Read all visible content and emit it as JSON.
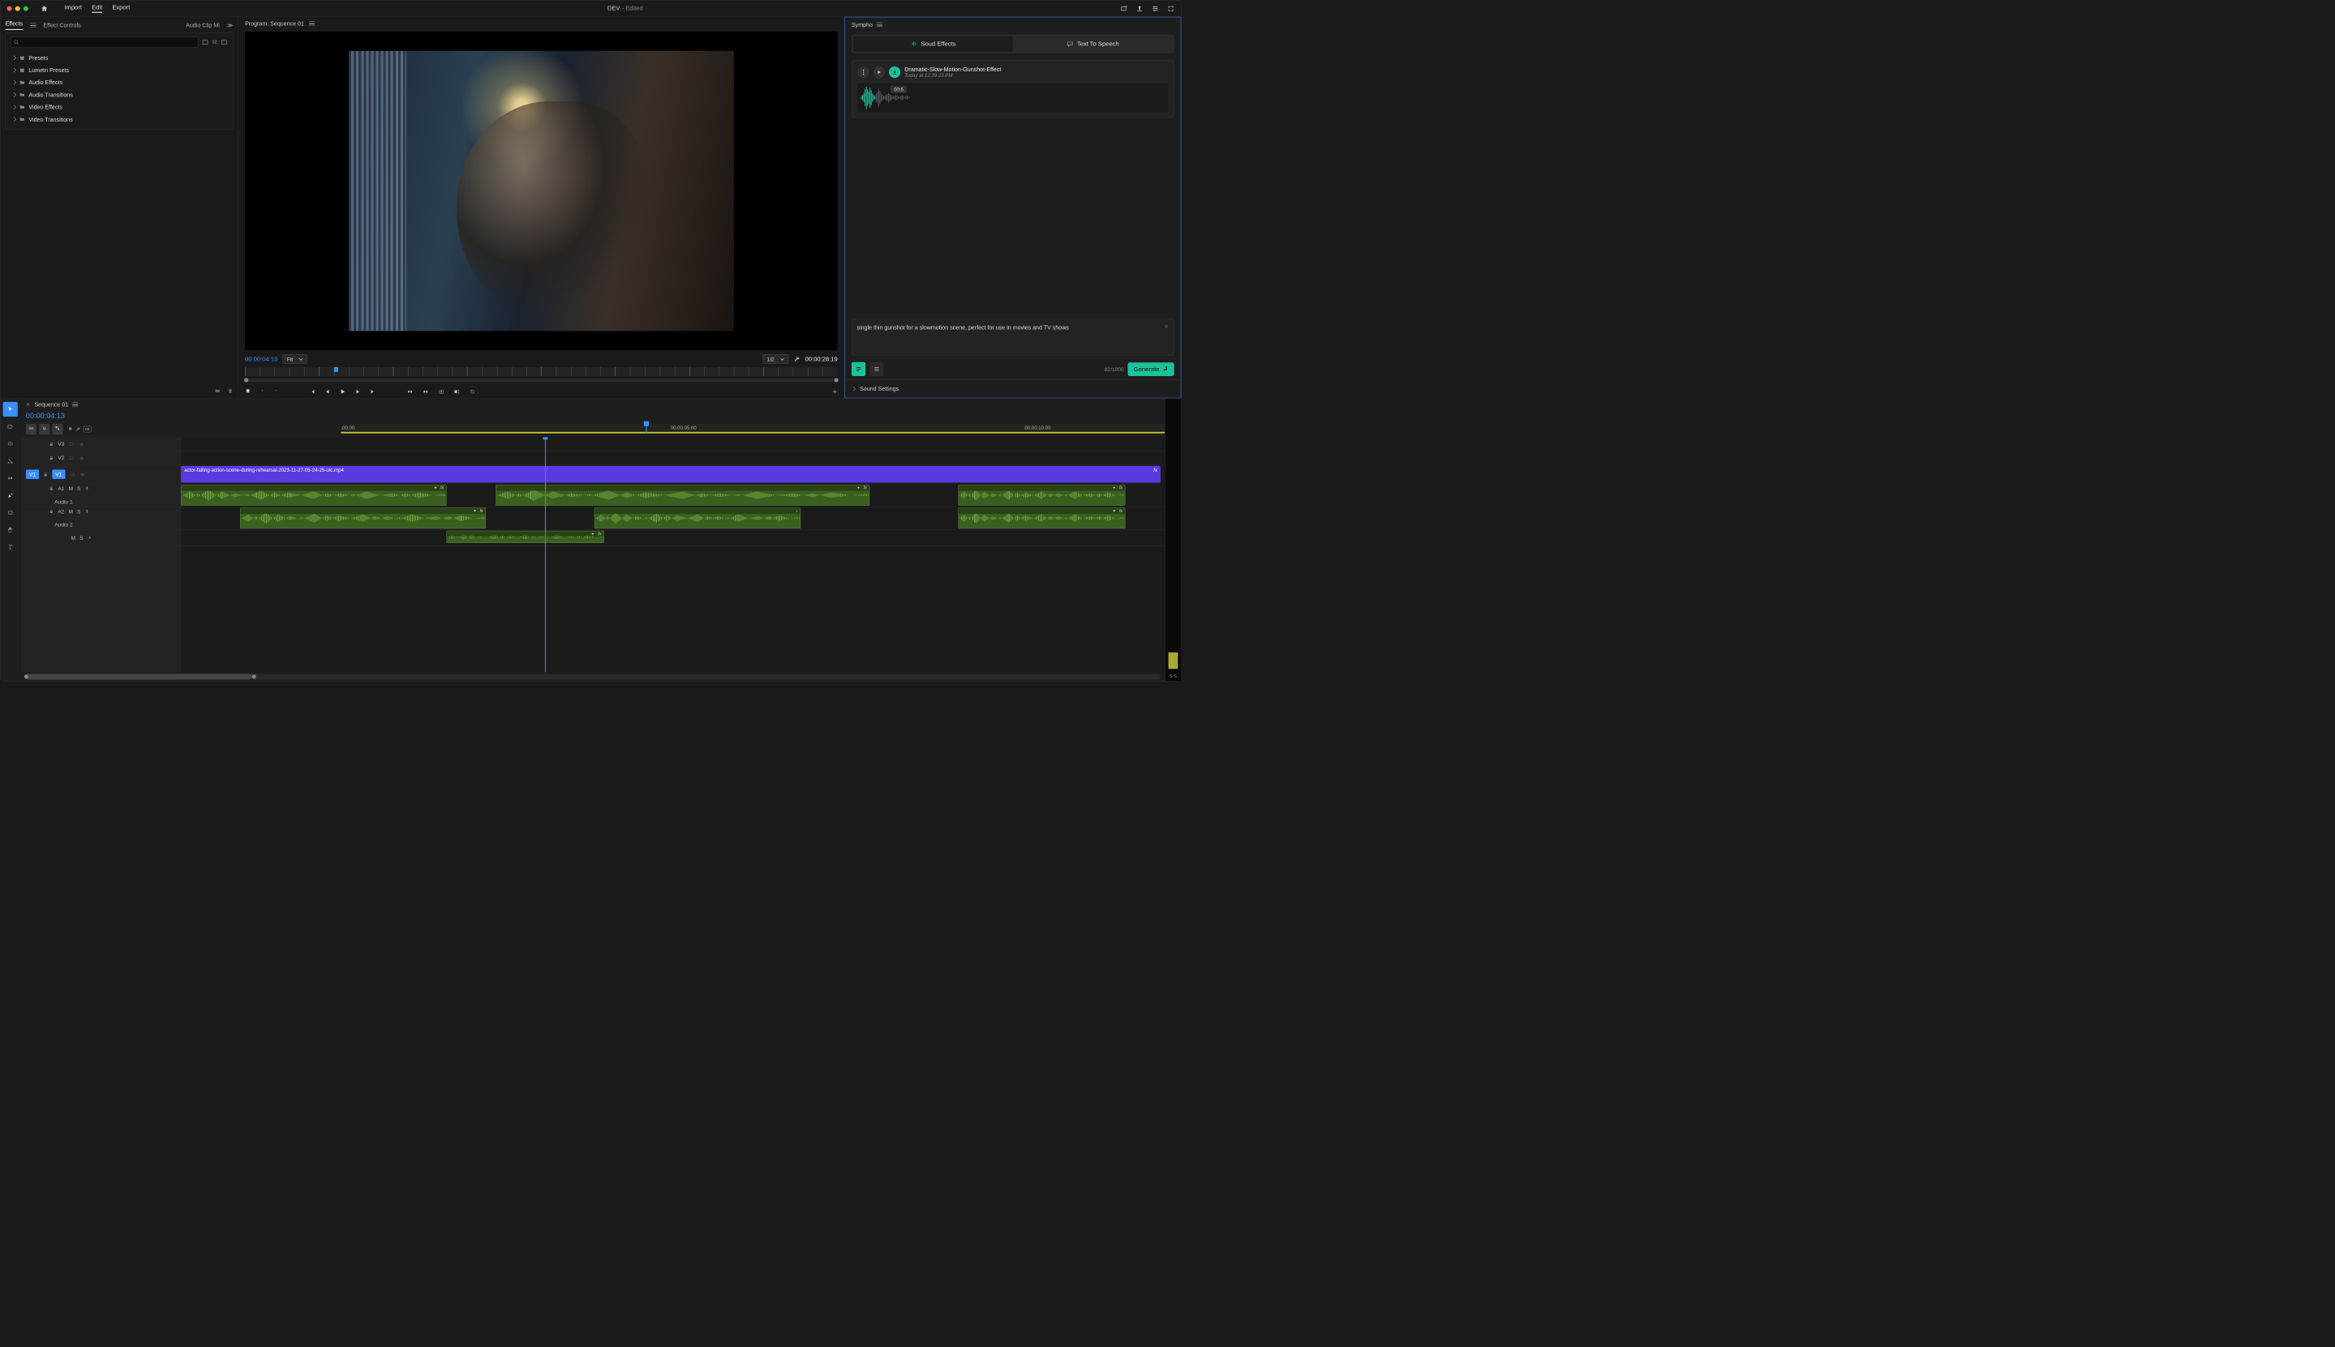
{
  "titlebar": {
    "menu": {
      "home": "⌂",
      "import": "Import",
      "edit": "Edit",
      "export": "Export"
    },
    "doc": "DEV",
    "doc_state": "- Edited"
  },
  "panels": {
    "effects": {
      "tab": "Effects",
      "controls": "Effect Controls",
      "mixer": "Audio Clip Mi",
      "search_placeholder": ""
    },
    "tree": {
      "presets": "Presets",
      "lumetri": "Lumetri Presets",
      "audio_fx": "Audio Effects",
      "audio_tr": "Audio Transitions",
      "video_fx": "Video Effects",
      "video_tr": "Video Transitions"
    },
    "badges": {
      "b1": "",
      "b2": "32",
      "b3": ""
    }
  },
  "program": {
    "title": "Program: Sequence 01",
    "tc_in": "00:00:04:13",
    "fit": "Fit",
    "scale": "1/2",
    "tc_out": "00:00:28:19"
  },
  "timeline": {
    "tab": "Sequence 01",
    "tc": "00:00:04:13",
    "ruler": {
      "t0": ":00:00",
      "t5": "00:00:05:00",
      "t10": "00:00:10:00"
    },
    "tracks": {
      "v3": "V3",
      "v2": "V2",
      "v1": "V1",
      "a1": "A1",
      "a2": "A2",
      "audio1": "Audio 1",
      "audio2": "Audio 2",
      "m": "M",
      "s": "S"
    },
    "clip": {
      "name": "actor-failing-action-scene-during-rehearsal-2023-11-27-05-24-25-utc.mp4",
      "fx": "fx"
    },
    "meter_label": "S  S"
  },
  "sympho": {
    "title": "Sympho",
    "tabs": {
      "sfx": "Soud Effects",
      "tts": "Text To Speech"
    },
    "result": {
      "title": "Dramatic-Slow-Motion-Gunshot-Effect",
      "sub": "Today at 12:39:23 PM",
      "tag": "00:6"
    },
    "prompt": "single thin gunshot for a slowmotion scene, perfect for use in movies and TV shows",
    "count": "82/1000",
    "generate": "Generate",
    "settings": "Sound Settings"
  }
}
